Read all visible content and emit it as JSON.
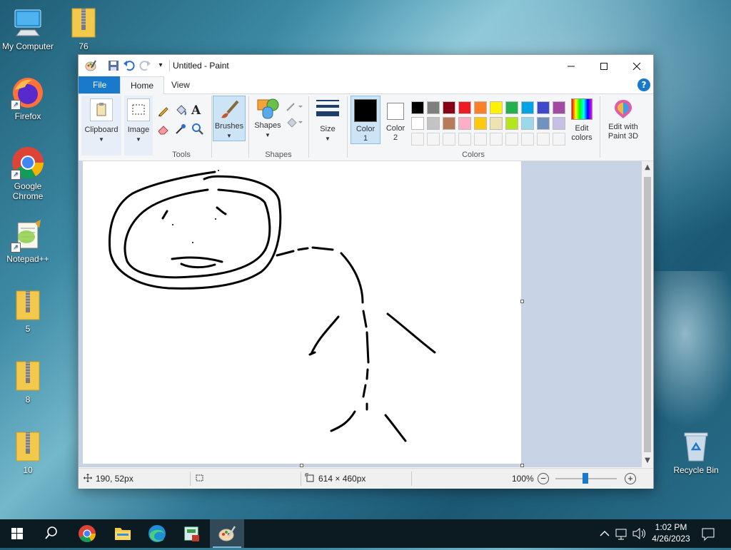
{
  "desktop": {
    "icons": [
      {
        "label": "My Computer"
      },
      {
        "label": "76"
      },
      {
        "label": "Firefox"
      },
      {
        "label": "Google Chrome"
      },
      {
        "label": "Notepad++"
      },
      {
        "label": "5"
      },
      {
        "label": "8"
      },
      {
        "label": "10"
      },
      {
        "label": "Recycle Bin"
      }
    ]
  },
  "window": {
    "title": "Untitled - Paint",
    "menu": {
      "file": "File",
      "home": "Home",
      "view": "View"
    },
    "ribbon": {
      "clipboard": "Clipboard",
      "image": "Image",
      "tools_group": "Tools",
      "brushes": "Brushes",
      "shapes": "Shapes",
      "shapes_group": "Shapes",
      "size": "Size",
      "color1": "Color",
      "color1_num": "1",
      "color2": "Color",
      "color2_num": "2",
      "colors_group": "Colors",
      "edit_colors_1": "Edit",
      "edit_colors_2": "colors",
      "paint3d_1": "Edit with",
      "paint3d_2": "Paint 3D",
      "text_tool": "A"
    },
    "palette_row1": [
      "#000000",
      "#7f7f7f",
      "#880015",
      "#ed1c24",
      "#ff7f27",
      "#fff200",
      "#22b14c",
      "#00a2e8",
      "#3f48cc",
      "#a349a4"
    ],
    "palette_row2": [
      "#ffffff",
      "#c3c3c3",
      "#b97a57",
      "#ffaec9",
      "#ffc90e",
      "#efe4b0",
      "#b5e61d",
      "#99d9ea",
      "#7092be",
      "#c8bfe7"
    ],
    "color1_value": "#000000",
    "color2_value": "#ffffff",
    "status": {
      "cursor_pos": "190, 52px",
      "canvas_size": "614 × 460px",
      "zoom": "100%"
    }
  },
  "taskbar": {
    "time": "1:02 PM",
    "date": "4/26/2023"
  }
}
